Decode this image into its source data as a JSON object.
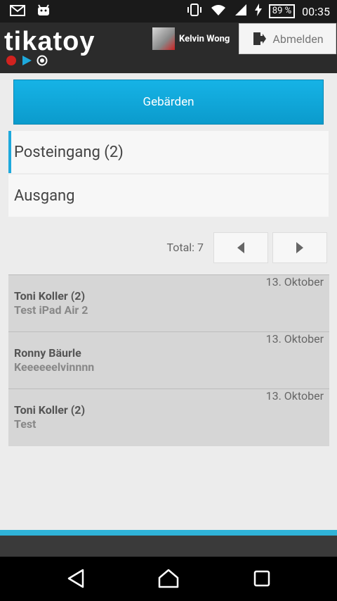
{
  "status_bar": {
    "battery": "89 %",
    "time": "00:35"
  },
  "app": {
    "logo": "tikatoy",
    "user_name": "Kelvin Wong",
    "logout_label": "Abmelden"
  },
  "main": {
    "primary_button": "Gebärden",
    "folders": [
      {
        "label": "Posteingang (2)",
        "active": true
      },
      {
        "label": "Ausgang",
        "active": false
      }
    ],
    "total_label": "Total: 7"
  },
  "messages": [
    {
      "date": "13. Oktober",
      "from": "Toni Koller (2)",
      "subject": "Test iPad Air 2"
    },
    {
      "date": "13. Oktober",
      "from": "Ronny Bäurle",
      "subject": "Keeeeeelvinnnn"
    },
    {
      "date": "13. Oktober",
      "from": "Toni Koller (2)",
      "subject": "Test"
    }
  ],
  "icons": {
    "logo_dots": [
      "#d1221f",
      "#1ea9dc",
      "#ffffff"
    ],
    "accent": "#1ea9dc"
  }
}
